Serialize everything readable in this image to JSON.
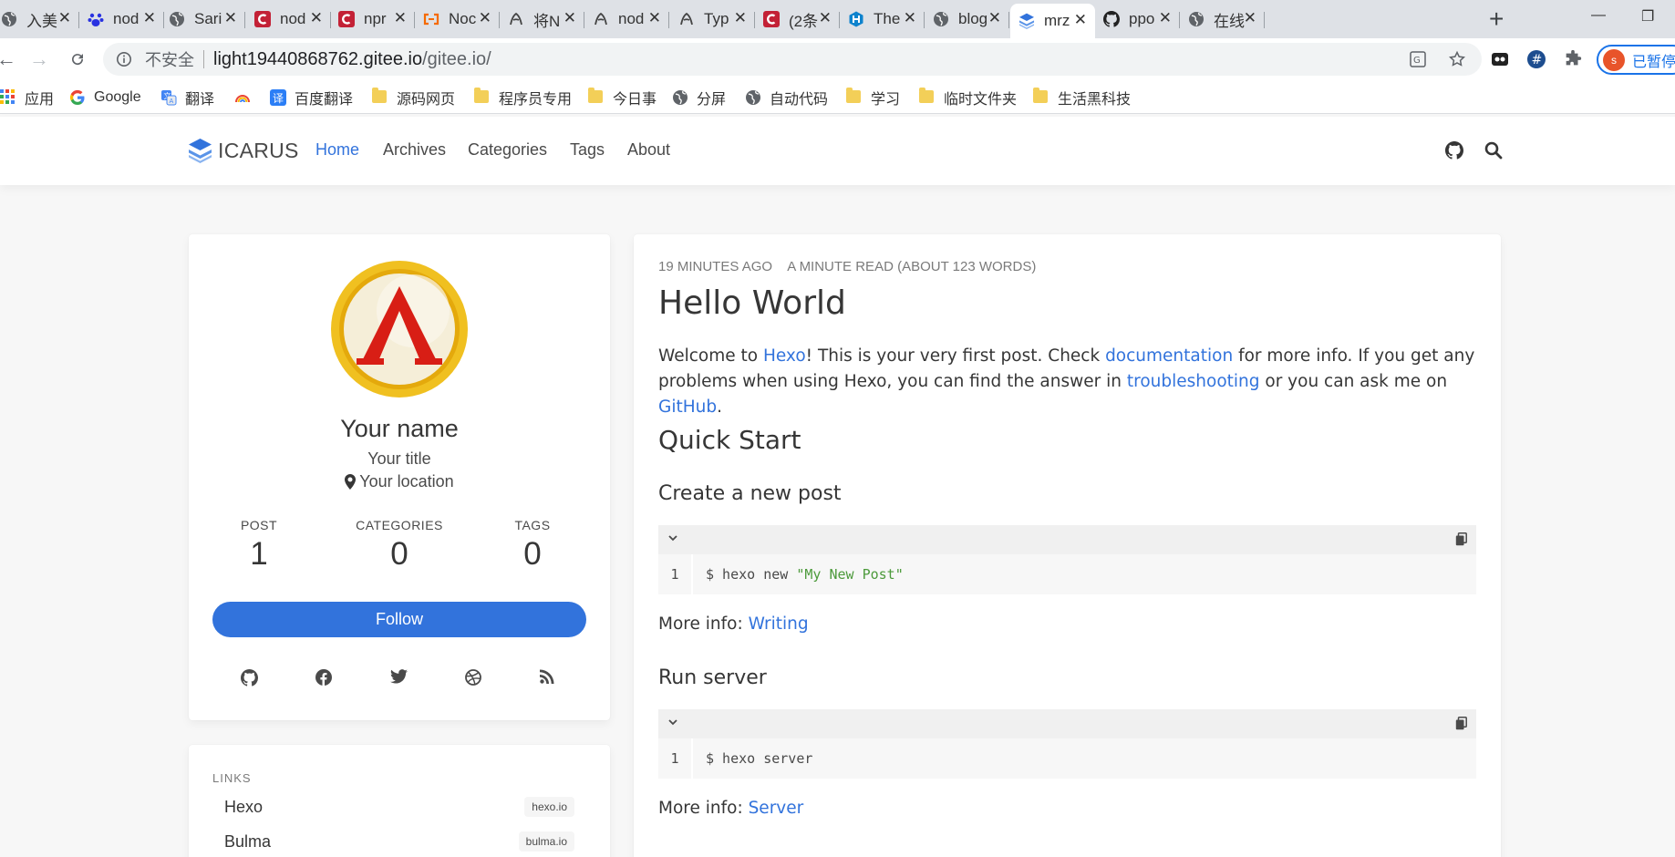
{
  "browser": {
    "tabs": [
      {
        "title": "入美",
        "icon": "globe"
      },
      {
        "title": "nod",
        "icon": "baidu"
      },
      {
        "title": "Sari",
        "icon": "globe"
      },
      {
        "title": "nod",
        "icon": "csdn"
      },
      {
        "title": "npr",
        "icon": "csdn"
      },
      {
        "title": "Noc",
        "icon": "bracket"
      },
      {
        "title": "将N",
        "icon": "yuque"
      },
      {
        "title": "nod",
        "icon": "yuque"
      },
      {
        "title": "Typ",
        "icon": "yuque"
      },
      {
        "title": "(2条",
        "icon": "csdn"
      },
      {
        "title": "The",
        "icon": "hexo"
      },
      {
        "title": "blog",
        "icon": "globe"
      },
      {
        "title": "mrz",
        "icon": "icarus",
        "active": true
      },
      {
        "title": "ppo",
        "icon": "github"
      },
      {
        "title": "在线",
        "icon": "globe"
      }
    ],
    "new_tab_label": "+",
    "insecure_label": "不安全",
    "url_host": "light19440868762.gitee.io",
    "url_path": "/gitee.io/",
    "profile_initial": "s",
    "profile_label": "已暂停",
    "bookmarks": [
      {
        "label": "应用",
        "icon": "apps"
      },
      {
        "label": "Google",
        "icon": "google"
      },
      {
        "label": "翻译",
        "icon": "translate"
      },
      {
        "label": "",
        "icon": "rainbow"
      },
      {
        "label": "百度翻译",
        "icon": "baidu-translate"
      },
      {
        "label": "源码网页",
        "icon": "folder"
      },
      {
        "label": "程序员专用",
        "icon": "folder"
      },
      {
        "label": "今日事",
        "icon": "folder"
      },
      {
        "label": "分屏",
        "icon": "globe"
      },
      {
        "label": "自动代码",
        "icon": "globe"
      },
      {
        "label": "学习",
        "icon": "folder"
      },
      {
        "label": "临时文件夹",
        "icon": "folder"
      },
      {
        "label": "生活黑科技",
        "icon": "folder"
      }
    ]
  },
  "site": {
    "logo_text": "ICARUS",
    "nav": [
      "Home",
      "Archives",
      "Categories",
      "Tags",
      "About"
    ],
    "active_nav": "Home"
  },
  "profile": {
    "name": "Your name",
    "title": "Your title",
    "location": "Your location",
    "stats": [
      {
        "label": "POST",
        "value": "1"
      },
      {
        "label": "CATEGORIES",
        "value": "0"
      },
      {
        "label": "TAGS",
        "value": "0"
      }
    ],
    "follow_label": "Follow",
    "social_icons": [
      "github-icon",
      "facebook-icon",
      "twitter-icon",
      "dribbble-icon",
      "rss-icon"
    ]
  },
  "links": {
    "title": "LINKS",
    "items": [
      {
        "name": "Hexo",
        "tag": "hexo.io"
      },
      {
        "name": "Bulma",
        "tag": "bulma.io"
      }
    ]
  },
  "post": {
    "time_ago": "19 MINUTES AGO",
    "read_time": "A MINUTE READ (ABOUT 123 WORDS)",
    "title": "Hello World",
    "intro": {
      "t1": "Welcome to ",
      "l1": "Hexo",
      "t2": "! This is your very first post. Check ",
      "l2": "documentation",
      "t3": " for more info. If you get any problems when using Hexo, you can find the answer in ",
      "l3": "troubleshooting",
      "t4": " or you can ask me on ",
      "l4": "GitHub",
      "t5": "."
    },
    "quick_start": "Quick Start",
    "create_heading": "Create a new post",
    "code1": {
      "line": "1",
      "cmd": "$ hexo new ",
      "str": "\"My New Post\""
    },
    "more1_text": "More info: ",
    "more1_link": "Writing",
    "run_heading": "Run server",
    "code2": {
      "line": "1",
      "cmd": "$ hexo server"
    },
    "more2_text": "More info: ",
    "more2_link": "Server"
  }
}
